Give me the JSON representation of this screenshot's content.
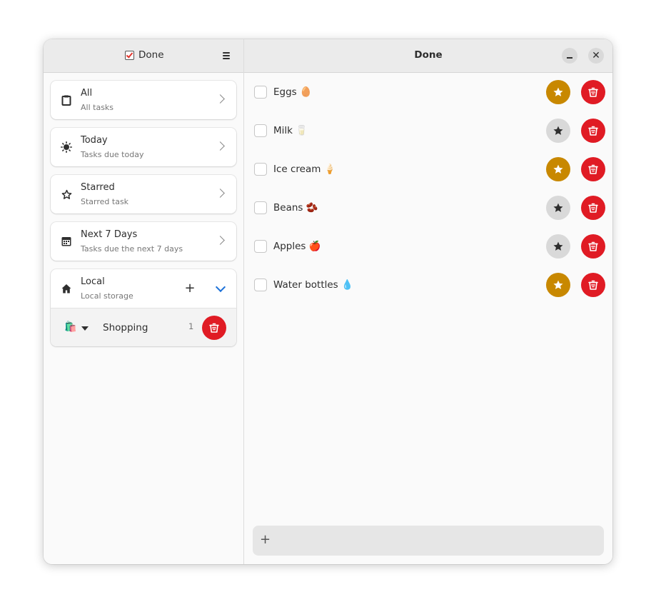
{
  "app": {
    "title": "Done",
    "accent": "#1c71d8",
    "star_on_color": "#c88800",
    "star_off_color": "#d9d9d9",
    "delete_color": "#e01b24"
  },
  "sidebar": {
    "header_title": "Done",
    "nav": [
      {
        "title": "All",
        "subtitle": "All tasks",
        "icon": "clipboard-icon"
      },
      {
        "title": "Today",
        "subtitle": "Tasks due today",
        "icon": "sun-icon"
      },
      {
        "title": "Starred",
        "subtitle": "Starred task",
        "icon": "star-icon"
      },
      {
        "title": "Next 7 Days",
        "subtitle": "Tasks due the next 7 days",
        "icon": "calendar-icon"
      }
    ],
    "provider": {
      "title": "Local",
      "subtitle": "Local storage",
      "add_label": "+",
      "lists": [
        {
          "emoji": "🛍️",
          "name": "Shopping",
          "count": "1"
        }
      ]
    }
  },
  "main": {
    "title": "Done",
    "tasks": [
      {
        "title": "Eggs 🥚",
        "starred": true
      },
      {
        "title": "Milk 🥛",
        "starred": false
      },
      {
        "title": "Ice cream 🍦",
        "starred": true
      },
      {
        "title": "Beans 🫘",
        "starred": false
      },
      {
        "title": "Apples 🍎",
        "starred": false
      },
      {
        "title": "Water bottles 💧",
        "starred": true
      }
    ],
    "add_label": "+"
  }
}
